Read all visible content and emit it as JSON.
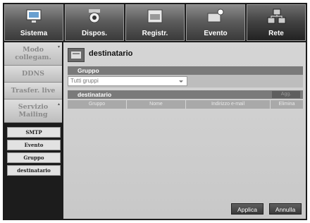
{
  "tabs": [
    {
      "label": "Sistema",
      "icon": "monitor-icon"
    },
    {
      "label": "Dispos.",
      "icon": "camera-icon"
    },
    {
      "label": "Registr.",
      "icon": "record-icon"
    },
    {
      "label": "Evento",
      "icon": "event-icon"
    },
    {
      "label": "Rete",
      "icon": "network-icon",
      "active": true
    }
  ],
  "nav": {
    "items": [
      {
        "label": "Modo collegam."
      },
      {
        "label": "DDNS"
      },
      {
        "label": "Trasfer. live"
      },
      {
        "label": "Servizio Mailing",
        "expanded": true
      }
    ],
    "subitems": [
      {
        "label": "SMTP"
      },
      {
        "label": "Evento"
      },
      {
        "label": "Gruppo"
      },
      {
        "label": "destinatario",
        "selected": true
      }
    ]
  },
  "main": {
    "title": "destinatario",
    "gruppo_section": "Gruppo",
    "gruppo_select_value": "Tutti gruppi",
    "recipients_section": "destinatario",
    "add_label": "Agg.",
    "columns": [
      "Gruppo",
      "Nome",
      "Indirizzo e-mail",
      "Elimina"
    ]
  },
  "buttons": {
    "apply": "Applica",
    "cancel": "Annulla"
  }
}
